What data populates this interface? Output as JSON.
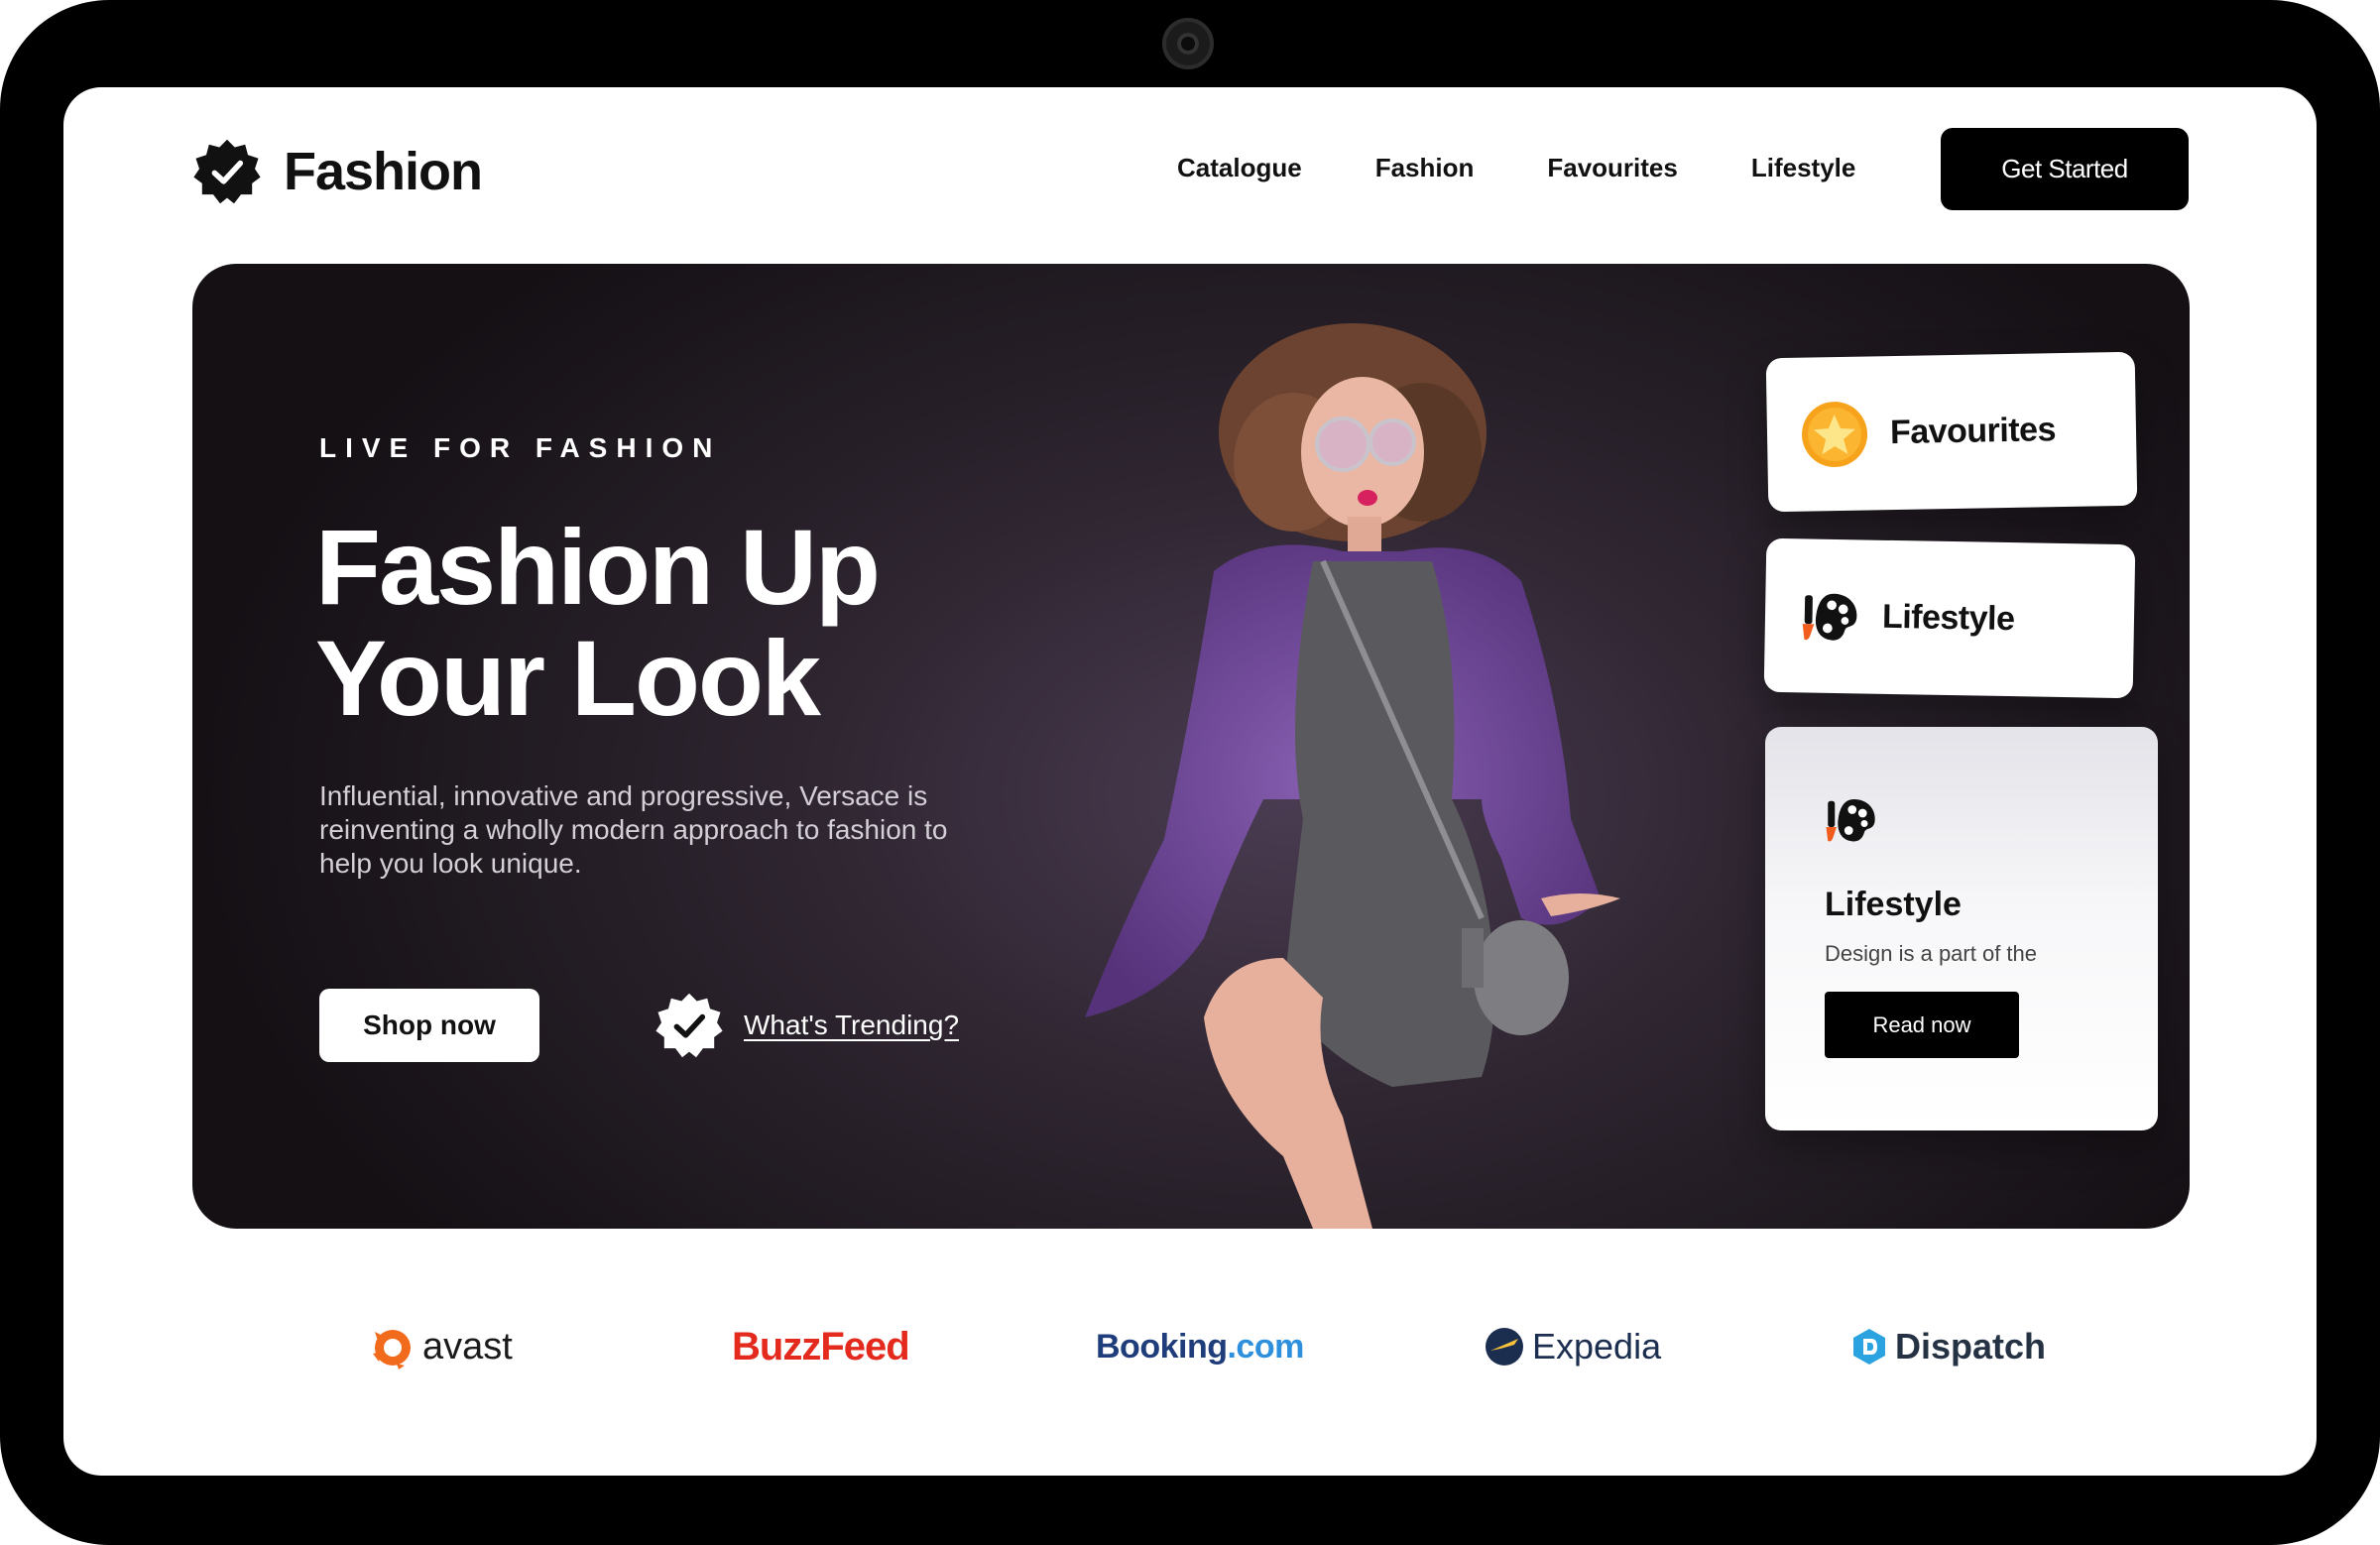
{
  "brand": {
    "name": "Fashion",
    "icon": "badge-check-icon"
  },
  "nav": {
    "items": [
      {
        "label": "Catalogue"
      },
      {
        "label": "Fashion"
      },
      {
        "label": "Favourites"
      },
      {
        "label": "Lifestyle"
      }
    ],
    "cta_label": "Get Started"
  },
  "hero": {
    "eyebrow": "LIVE FOR FASHION",
    "headline_line1": "Fashion Up",
    "headline_line2": "Your Look",
    "description": "Influential, innovative and progressive, Versace is reinventing a wholly modern approach to fashion to help you look unique.",
    "shop_label": "Shop now",
    "trending_label": "What's Trending?",
    "trending_icon": "badge-check-icon"
  },
  "cards": {
    "favourites": {
      "title": "Favourites",
      "icon": "star-icon"
    },
    "lifestyle": {
      "title": "Lifestyle",
      "icon": "palette-brush-icon"
    },
    "feature": {
      "title": "Lifestyle",
      "description": "Design is a part of the",
      "button_label": "Read now",
      "icon": "palette-brush-icon"
    }
  },
  "brands": {
    "avast": "avast",
    "buzzfeed": "BuzzFeed",
    "booking_1": "Booking",
    "booking_2": ".com",
    "expedia": "Expedia",
    "dispatch": "Dispatch"
  },
  "colors": {
    "accent": "#000000",
    "hero_bg": "#2e2530",
    "star": "#f7a21b",
    "buzzfeed": "#e32a1d",
    "booking_dark": "#1f3d7a",
    "booking_light": "#2e8fdd",
    "avast": "#f26b1d"
  }
}
